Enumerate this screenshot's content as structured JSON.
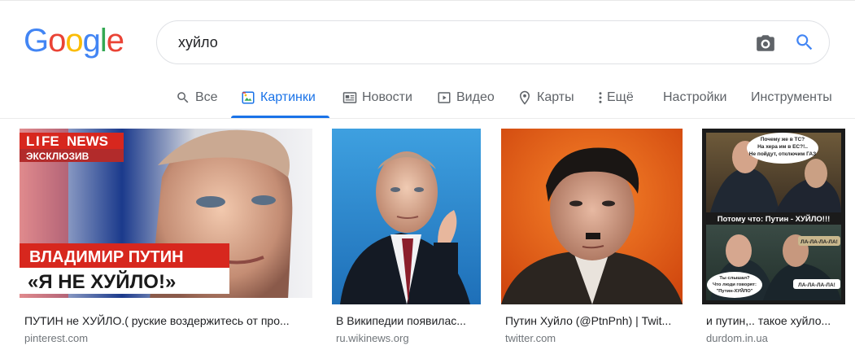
{
  "logo": {
    "letters": [
      "G",
      "o",
      "o",
      "g",
      "l",
      "e"
    ],
    "colors": [
      "#4285f4",
      "#ea4335",
      "#fbbc05",
      "#4285f4",
      "#34a853",
      "#ea4335"
    ]
  },
  "search": {
    "query": "хуйло",
    "icons": [
      "camera-icon",
      "search-icon"
    ]
  },
  "tabs": [
    {
      "label": "Все",
      "icon": "search-icon"
    },
    {
      "label": "Картинки",
      "icon": "image-icon",
      "active": true
    },
    {
      "label": "Новости",
      "icon": "news-icon"
    },
    {
      "label": "Видео",
      "icon": "video-icon"
    },
    {
      "label": "Карты",
      "icon": "map-pin-icon"
    },
    {
      "label": "Ещё",
      "icon": "more-vert-icon"
    },
    {
      "label": "Настройки"
    },
    {
      "label": "Инструменты"
    }
  ],
  "results": [
    {
      "title": "ПУТИН не ХУЙЛО.( руские воздержитесь от про...",
      "source": "pinterest.com",
      "overlay": {
        "logo_l": "L",
        "logo_i": "I",
        "logo_fe": "FE",
        "logo_news": "NEWS",
        "tag": "ЭКСКЛЮЗИВ",
        "name": "ВЛАДИМИР ПУТИН",
        "quote": "«Я НЕ ХУЙЛО!»"
      }
    },
    {
      "title": "В Википедии появилас...",
      "source": "ru.wikinews.org"
    },
    {
      "title": "Путин Хуйло (@PtnPnh) | Twit...",
      "source": "twitter.com"
    },
    {
      "title": "и путин,.. такое хуйло...",
      "source": "durdom.in.ua",
      "overlay": {
        "bubble1": [
          "Почему же в ТС?",
          "На хера им в ЕС?!..",
          "Не пойдут, отключим ГАЗ"
        ],
        "caption": "Потому что: Путин - ХУЙЛО!!!",
        "laugh": "ЛА-ЛА-ЛА-ЛА!",
        "bubble2": [
          "Ты слышал?",
          "Что люди говорят:",
          "\"Путин-ХУЙЛО\""
        ],
        "laugh2": "ЛА-ЛА-ЛА-ЛА!"
      }
    }
  ]
}
